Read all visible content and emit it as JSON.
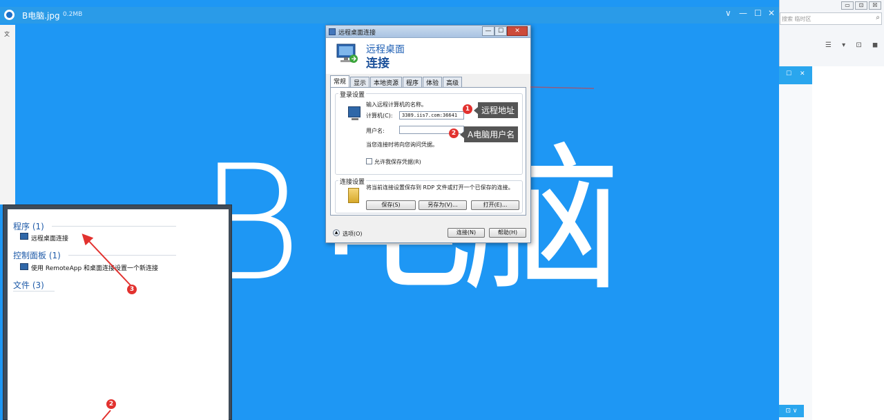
{
  "viewer": {
    "title": "B电脑.jpg",
    "size": "0.2MB",
    "controls": [
      "∨",
      "—",
      "☐",
      "✕"
    ],
    "big_text": [
      "B",
      "电",
      "脑"
    ]
  },
  "left_strip": {
    "items": [
      "文",
      " "
    ]
  },
  "browser_right": {
    "search_placeholder": "搜索 临时区",
    "win_buttons": [
      "▭",
      "⊡",
      "☒"
    ],
    "toolbar": "☰ ▾ ⊡ ◼"
  },
  "rdp": {
    "title": "远程桌面连接",
    "header_line1": "远程桌面",
    "header_line2": "连接",
    "tabs": [
      "常规",
      "显示",
      "本地资源",
      "程序",
      "体验",
      "高级"
    ],
    "login_group": "登录设置",
    "login_prompt": "输入远程计算机的名称。",
    "computer_label": "计算机(C):",
    "computer_value": "3389.iis7.com:36641",
    "username_label": "用户名:",
    "username_value": "",
    "credential_note": "当您连接时将向您询问凭据。",
    "save_credential": "允许我保存凭据(R)",
    "conn_group": "连接设置",
    "conn_desc": "将当前连接设置保存到 RDP 文件或打开一个已保存的连接。",
    "btn_save": "保存(S)",
    "btn_save_as": "另存为(V)...",
    "btn_open": "打开(E)...",
    "options": "选项(O)",
    "btn_connect": "连接(N)",
    "btn_help": "帮助(H)"
  },
  "annotations": {
    "badge1": "1",
    "callout1": "远程地址",
    "badge2": "2",
    "callout2": "A电脑用户名",
    "badge3": "3",
    "badge_bottom": "2"
  },
  "start_menu": {
    "cat_programs": "程序 (1)",
    "item_rdp": "远程桌面连接",
    "cat_control": "控制面板 (1)",
    "item_remoteapp": "使用 RemoteApp 和桌面连接设置一个新连接",
    "cat_files": "文件 (3)"
  },
  "colors": {
    "background": "#1e97f4",
    "accent_red": "#e2322f",
    "link_blue": "#1e5aa8"
  }
}
